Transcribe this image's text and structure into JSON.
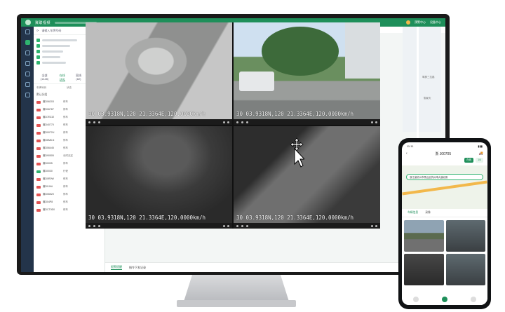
{
  "app": {
    "brand": "冀联视频",
    "header_right": [
      "预警中心",
      "设备中心"
    ]
  },
  "panel": {
    "search_placeholder": "请输入车牌号码",
    "tabs": [
      {
        "label": "全部",
        "count": "(1448)"
      },
      {
        "label": "在线",
        "count": "(44)"
      },
      {
        "label": "离线",
        "count": "(82)"
      },
      {
        "label": "报警",
        "count": "(82)"
      }
    ],
    "columns": [
      "车牌号码",
      "状态",
      "全部设备"
    ],
    "group": "默认分组",
    "vehicles": [
      {
        "plate": "冀D06203",
        "status": "停车",
        "online": false
      },
      {
        "plate": "冀D06787",
        "status": "停车",
        "online": false
      },
      {
        "plate": "冀D7E332",
        "status": "停车",
        "online": false
      },
      {
        "plate": "冀D40770",
        "status": "停车",
        "online": false
      },
      {
        "plate": "冀D0072U",
        "status": "停车",
        "online": false
      },
      {
        "plate": "冀D6MD.6",
        "status": "停车",
        "online": false
      },
      {
        "plate": "冀D06445",
        "status": "停车",
        "online": false
      },
      {
        "plate": "冀D90505",
        "status": "长时无定",
        "online": false
      },
      {
        "plate": "冀D0005",
        "status": "停车",
        "online": false
      },
      {
        "plate": "冀D0030",
        "status": "行驶",
        "online": true
      },
      {
        "plate": "冀D0R0W",
        "status": "停车",
        "online": false
      },
      {
        "plate": "冀D0J4U",
        "status": "停车",
        "online": false
      },
      {
        "plate": "冀D06520",
        "status": "停车",
        "online": false
      },
      {
        "plate": "冀D04P8",
        "status": "停车",
        "online": false
      },
      {
        "plate": "冀DCT0D0",
        "status": "停车",
        "online": false
      }
    ]
  },
  "toolbar": {
    "items": [
      "视频/图像",
      "图像全屏"
    ]
  },
  "videos": [
    {
      "osd": "30 03.9318N,120 21.3364E,120.0000km/h"
    },
    {
      "osd": "30 03.9318N,120 21.3364E,120.0000km/h"
    },
    {
      "osd": "30 03.9318N,120 21.3364E,120.0000km/h"
    },
    {
      "osd": "30 03.9318N,120 21.3364E,120.0000km/h"
    }
  ],
  "bottombar": {
    "tabs": [
      "报警提醒",
      "指令下发记录"
    ]
  },
  "mapstrip": {
    "labels": [
      "翠屏三拉路",
      "御景天"
    ]
  },
  "phone": {
    "time": "11:11",
    "title": "浙 J00705",
    "chips": [
      "在线",
      "1/4"
    ],
    "banner": "浙江省杭州市萧山区杭州湾大道北侧",
    "tabs": [
      "车辆信息",
      "录像"
    ],
    "video_count": 4
  },
  "colors": {
    "accent": "#1e8f5a",
    "sidebar": "#23344a",
    "alert": "#e05454",
    "online": "#2fb36f"
  }
}
